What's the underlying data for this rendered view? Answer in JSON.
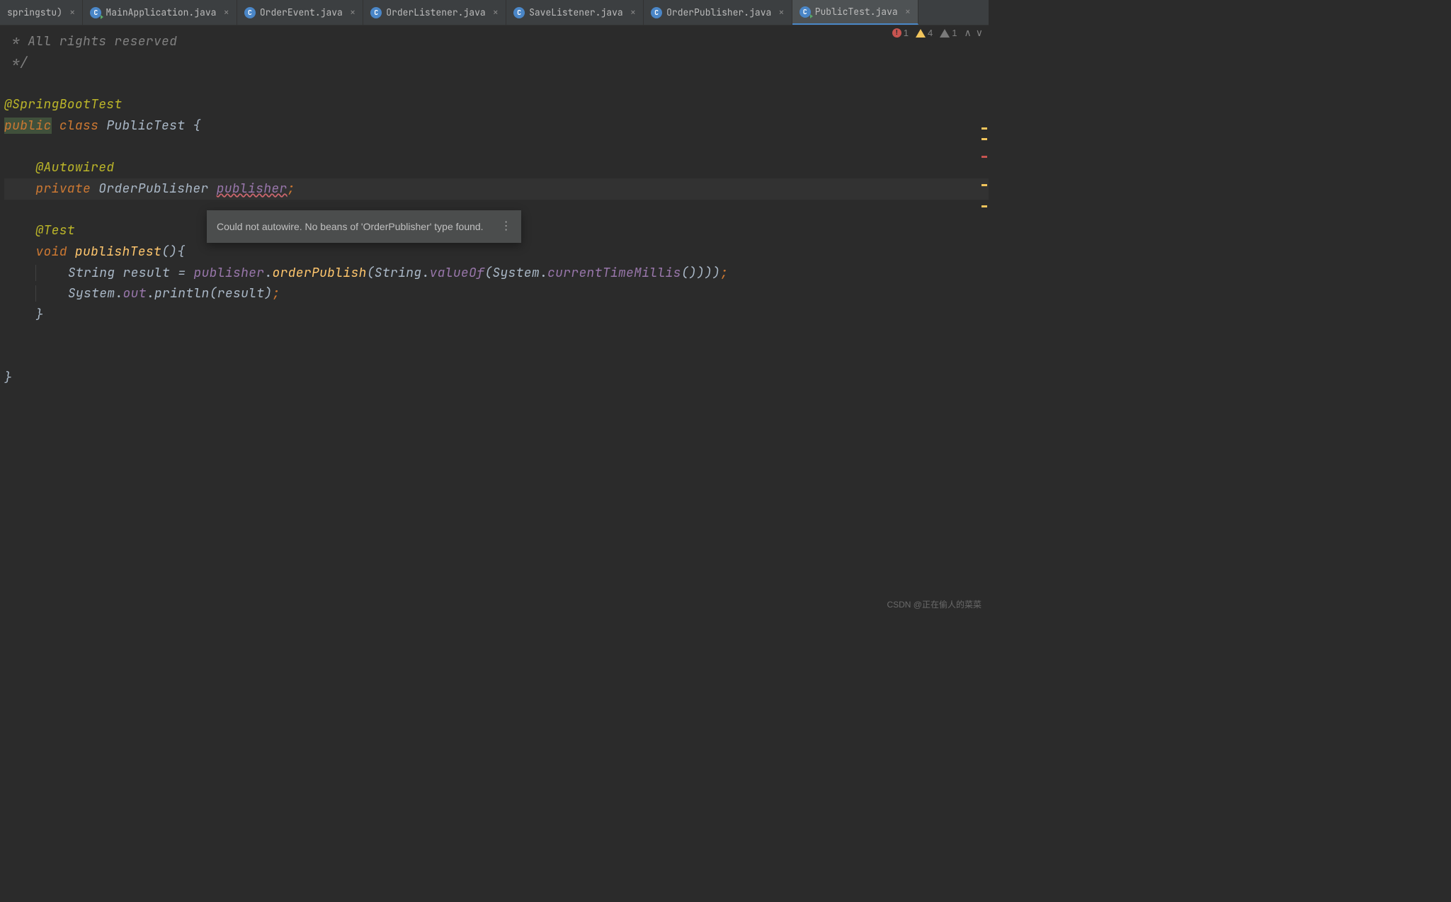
{
  "tabs": [
    {
      "label": "springstu)",
      "icon_type": "none",
      "active": false
    },
    {
      "label": "MainApplication.java",
      "icon_type": "run",
      "active": false
    },
    {
      "label": "OrderEvent.java",
      "icon_type": "class",
      "active": false
    },
    {
      "label": "OrderListener.java",
      "icon_type": "class",
      "active": false
    },
    {
      "label": "SaveListener.java",
      "icon_type": "class",
      "active": false
    },
    {
      "label": "OrderPublisher.java",
      "icon_type": "class",
      "active": false
    },
    {
      "label": "PublicTest.java",
      "icon_type": "run",
      "active": true
    }
  ],
  "inspections": {
    "errors": "1",
    "warnings": "4",
    "weak_warnings": "1"
  },
  "code": {
    "comment1": " * All rights reserved",
    "comment2": " */",
    "anno_springboot": "@SpringBootTest",
    "kw_public": "public",
    "kw_class": "class",
    "class_name": "PublicTest",
    "brace_open": "{",
    "anno_autowired": "@Autowired",
    "kw_private": "private",
    "type_orderpub": "OrderPublisher",
    "field_publisher": "publisher",
    "semi": ";",
    "anno_test": "@Test",
    "kw_void": "void",
    "method_publishtest": "publishTest",
    "parens": "()",
    "brace_open2": "{",
    "type_string": "String",
    "var_result": "result",
    "eq": "=",
    "ref_publisher": "publisher",
    "dot": ".",
    "m_orderpublish": "orderPublish",
    "paren_open": "(",
    "ref_string": "String",
    "m_valueof": "valueOf",
    "ref_system": "System",
    "m_currenttime": "currentTimeMillis",
    "empty_parens": "()",
    "paren_close3": ")))",
    "ref_system2": "System",
    "ref_out": "out",
    "m_println": "println",
    "ref_result": "result",
    "paren_close1": ")",
    "brace_close": "}",
    "brace_close2": "}"
  },
  "tooltip": {
    "text": "Could not autowire. No beans of 'OrderPublisher' type found."
  },
  "watermark": "CSDN @正在偷人的菜菜"
}
